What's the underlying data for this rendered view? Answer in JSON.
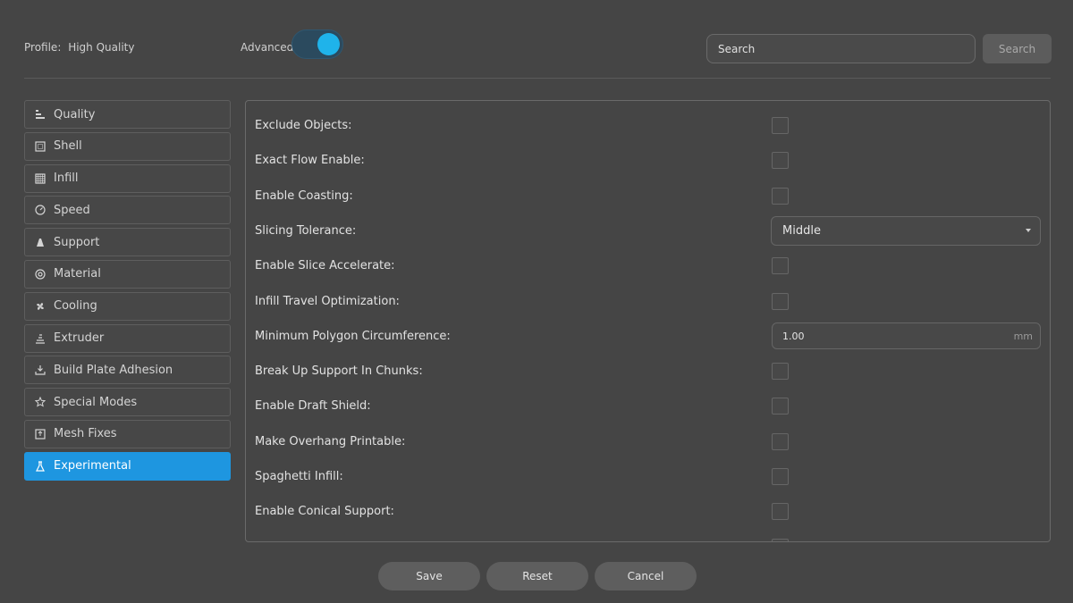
{
  "header": {
    "profile_label": "Profile:",
    "profile_value": "High Quality",
    "advanced_label": "Advanced",
    "advanced_on": true,
    "search_placeholder": "Search",
    "search_button": "Search"
  },
  "sidebar": {
    "items": [
      {
        "label": "Quality",
        "icon": "quality-icon"
      },
      {
        "label": "Shell",
        "icon": "shell-icon"
      },
      {
        "label": "Infill",
        "icon": "infill-icon"
      },
      {
        "label": "Speed",
        "icon": "speed-icon"
      },
      {
        "label": "Support",
        "icon": "support-icon"
      },
      {
        "label": "Material",
        "icon": "material-icon"
      },
      {
        "label": "Cooling",
        "icon": "fan-icon"
      },
      {
        "label": "Extruder",
        "icon": "extruder-icon"
      },
      {
        "label": "Build Plate Adhesion",
        "icon": "build-plate-icon"
      },
      {
        "label": "Special Modes",
        "icon": "star-icon"
      },
      {
        "label": "Mesh Fixes",
        "icon": "mesh-icon"
      },
      {
        "label": "Experimental",
        "icon": "flask-icon",
        "active": true
      }
    ]
  },
  "settings": {
    "rows": [
      {
        "label": "Exclude Objects:",
        "type": "checkbox"
      },
      {
        "label": "Exact Flow Enable:",
        "type": "checkbox"
      },
      {
        "label": "Enable Coasting:",
        "type": "checkbox"
      },
      {
        "label": "Slicing Tolerance:",
        "type": "select",
        "value": "Middle"
      },
      {
        "label": "Enable Slice Accelerate:",
        "type": "checkbox"
      },
      {
        "label": "Infill Travel Optimization:",
        "type": "checkbox"
      },
      {
        "label": "Minimum Polygon Circumference:",
        "type": "number",
        "value": "1.00",
        "unit": "mm"
      },
      {
        "label": "Break Up Support In Chunks:",
        "type": "checkbox"
      },
      {
        "label": "Enable Draft Shield:",
        "type": "checkbox"
      },
      {
        "label": "Make Overhang Printable:",
        "type": "checkbox"
      },
      {
        "label": "Spaghetti Infill:",
        "type": "checkbox"
      },
      {
        "label": "Enable Conical Support:",
        "type": "checkbox"
      }
    ]
  },
  "footer": {
    "save": "Save",
    "reset": "Reset",
    "cancel": "Cancel"
  },
  "colors": {
    "accent": "#1e96e0",
    "toggle_knob": "#1fb3ea",
    "background": "#454545"
  }
}
